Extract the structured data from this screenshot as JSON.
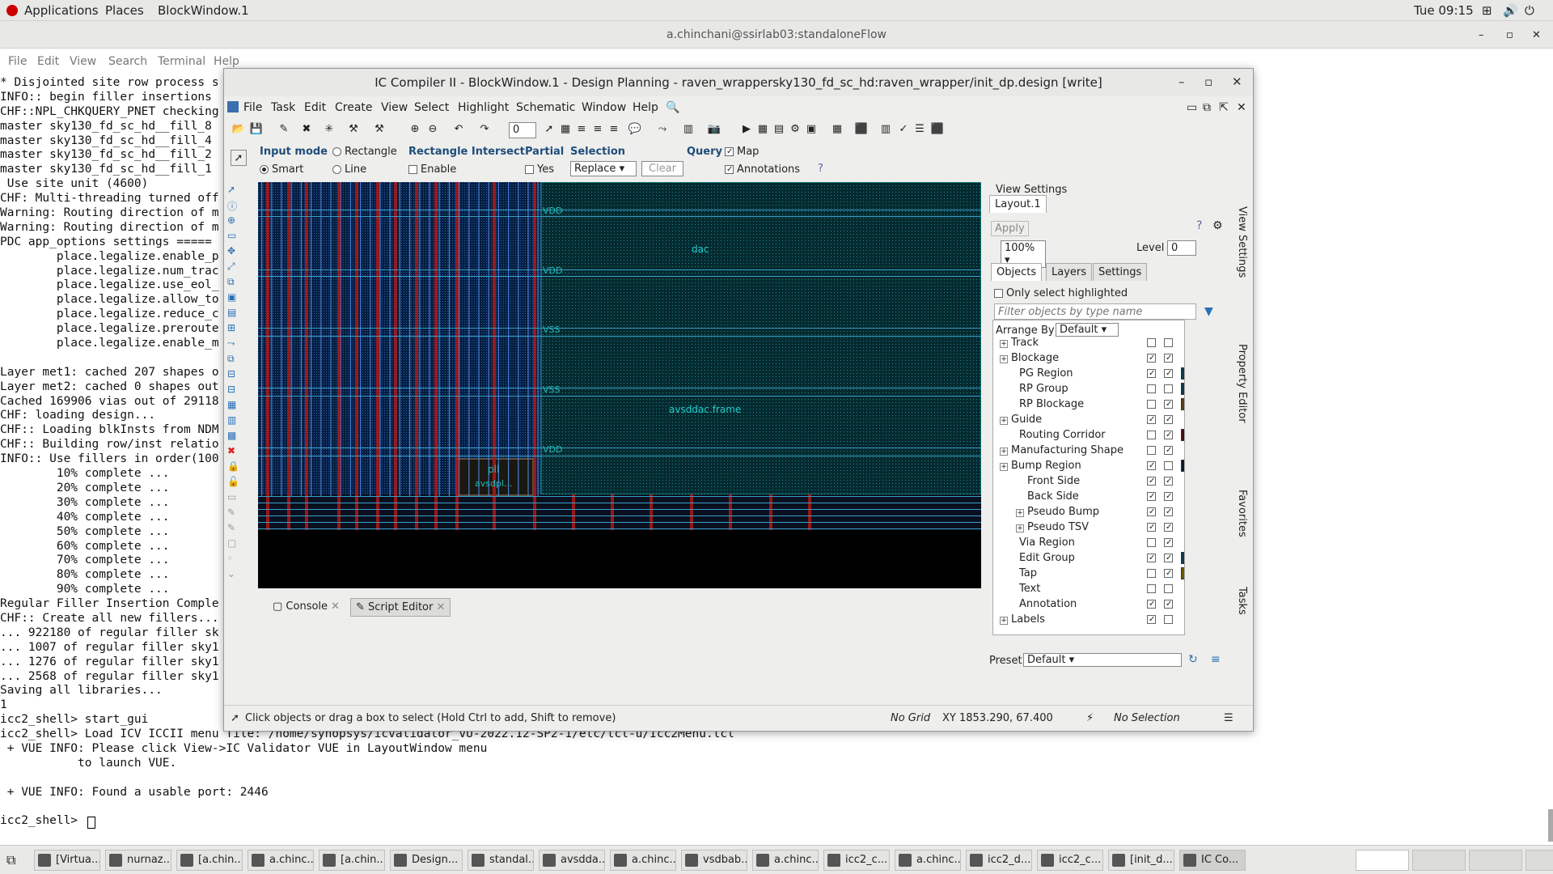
{
  "topbar": {
    "applications": "Applications",
    "places": "Places",
    "window": "BlockWindow.1",
    "clock": "Tue 09:15"
  },
  "terminal": {
    "title": "a.chinchani@ssirlab03:standaloneFlow",
    "menu": [
      "File",
      "Edit",
      "View",
      "Search",
      "Terminal",
      "Help"
    ],
    "lines": [
      "* Disjointed site row process s",
      "INFO:: begin filler insertions",
      "CHF::NPL_CHKQUERY_PNET checking",
      "master sky130_fd_sc_hd__fill_8",
      "master sky130_fd_sc_hd__fill_4",
      "master sky130_fd_sc_hd__fill_2",
      "master sky130_fd_sc_hd__fill_1",
      " Use site unit (4600)",
      "CHF: Multi-threading turned off",
      "Warning: Routing direction of m",
      "Warning: Routing direction of m",
      "PDC app_options settings =====",
      "        place.legalize.enable_p",
      "        place.legalize.num_trac",
      "        place.legalize.use_eol_",
      "        place.legalize.allow_to",
      "        place.legalize.reduce_c",
      "        place.legalize.preroute",
      "        place.legalize.enable_m",
      "",
      "Layer met1: cached 207 shapes o",
      "Layer met2: cached 0 shapes out",
      "Cached 169906 vias out of 29118",
      "CHF: loading design...",
      "CHF:: Loading blkInsts from NDM",
      "CHF:: Building row/inst relatio",
      "INFO:: Use fillers in order(100",
      "        10% complete ...",
      "        20% complete ...",
      "        30% complete ...",
      "        40% complete ...",
      "        50% complete ...",
      "        60% complete ...",
      "        70% complete ...",
      "        80% complete ...",
      "        90% complete ...",
      "Regular Filler Insertion Comple",
      "CHF:: Create all new fillers...",
      "... 922180 of regular filler sk",
      "... 1007 of regular filler sky1",
      "... 1276 of regular filler sky1",
      "... 2568 of regular filler sky1",
      "Saving all libraries...",
      "1",
      "icc2_shell> start_gui",
      "icc2_shell> Load ICV ICCII menu file: /home/synopsys/icvalidator_vU-2022.12-SP2-1/etc/tcl-u/Icc2Menu.tcl",
      " + VUE INFO: Please click View->IC Validator VUE in LayoutWindow menu",
      "           to launch VUE.",
      "",
      " + VUE INFO: Found a usable port: 2446",
      "",
      "icc2_shell> "
    ]
  },
  "window": {
    "title": "IC Compiler II - BlockWindow.1 - Design Planning - raven_wrappersky130_fd_sc_hd:raven_wrapper/init_dp.design [write]",
    "menu": [
      "File",
      "Task",
      "Edit",
      "Create",
      "View",
      "Select",
      "Highlight",
      "Schematic",
      "Window",
      "Help"
    ],
    "toolbar_value": "0",
    "options": {
      "input_mode": "Input mode",
      "rectangle": "Rectangle",
      "smart": "Smart",
      "line": "Line",
      "rect_intersect": "Rectangle Intersect",
      "enable": "Enable",
      "partial": "Partial",
      "yes": "Yes",
      "selection": "Selection",
      "replace": "Replace",
      "clear": "Clear",
      "query": "Query",
      "map": "Map",
      "annotations": "Annotations"
    },
    "canvas_labels": {
      "vdd1": "VDD",
      "vdd2": "VDD",
      "vss1": "VSS",
      "vss2": "VSS",
      "vdd3": "VDD",
      "dac": "dac",
      "frame": "avsddac.frame",
      "pll": "pll",
      "avsdpll": "avsdpl..."
    },
    "bottom_tabs": [
      "Console",
      "Script Editor"
    ],
    "status": {
      "hint": "Click objects or drag a box to select (Hold Ctrl to add, Shift to remove)",
      "grid": "No Grid",
      "xy": "XY 1853.290, 67.400",
      "selection": "No Selection"
    }
  },
  "panel": {
    "title": "View Settings",
    "layout_tab": "Layout.1",
    "apply": "Apply",
    "zoom": "100%",
    "level_label": "Level",
    "level": "0",
    "tabs": [
      "Objects",
      "Layers",
      "Settings"
    ],
    "only_highlighted": "Only select highlighted",
    "filter_placeholder": "Filter objects by type name",
    "arrange_label": "Arrange By",
    "arrange_value": "Default",
    "preset_label": "Preset",
    "preset_value": "Default",
    "vtabs": [
      "View Settings",
      "Property Editor",
      "Favorites",
      "Tasks"
    ],
    "tree": [
      {
        "label": "Track",
        "indent": 0,
        "exp": true,
        "c1": false,
        "c2": false,
        "sw": ""
      },
      {
        "label": "Blockage",
        "indent": 0,
        "exp": true,
        "c1": true,
        "c2": true,
        "sw": ""
      },
      {
        "label": "PG Region",
        "indent": 1,
        "exp": false,
        "c1": true,
        "c2": true,
        "sw": "#0d3b4a"
      },
      {
        "label": "RP Group",
        "indent": 1,
        "exp": false,
        "c1": false,
        "c2": false,
        "sw": "#0d3b4a"
      },
      {
        "label": "RP Blockage",
        "indent": 1,
        "exp": false,
        "c1": false,
        "c2": true,
        "sw": "#5a4010"
      },
      {
        "label": "Guide",
        "indent": 0,
        "exp": true,
        "c1": true,
        "c2": true,
        "sw": ""
      },
      {
        "label": "Routing Corridor",
        "indent": 1,
        "exp": false,
        "c1": false,
        "c2": true,
        "sw": "#4a0d0d"
      },
      {
        "label": "Manufacturing Shape",
        "indent": 0,
        "exp": true,
        "c1": false,
        "c2": true,
        "sw": ""
      },
      {
        "label": "Bump Region",
        "indent": 0,
        "exp": true,
        "c1": true,
        "c2": false,
        "sw": "#0d1a2e"
      },
      {
        "label": "Front Side",
        "indent": 2,
        "exp": false,
        "c1": true,
        "c2": true,
        "sw": ""
      },
      {
        "label": "Back Side",
        "indent": 2,
        "exp": false,
        "c1": true,
        "c2": true,
        "sw": ""
      },
      {
        "label": "Pseudo Bump",
        "indent": 2,
        "exp": true,
        "c1": true,
        "c2": true,
        "sw": ""
      },
      {
        "label": "Pseudo TSV",
        "indent": 2,
        "exp": true,
        "c1": true,
        "c2": true,
        "sw": ""
      },
      {
        "label": "Via Region",
        "indent": 1,
        "exp": false,
        "c1": false,
        "c2": true,
        "sw": ""
      },
      {
        "label": "Edit Group",
        "indent": 1,
        "exp": false,
        "c1": true,
        "c2": true,
        "sw": "#0d3b4a"
      },
      {
        "label": "Tap",
        "indent": 1,
        "exp": false,
        "c1": false,
        "c2": true,
        "sw": "#6a5a00"
      },
      {
        "label": "Text",
        "indent": 1,
        "exp": false,
        "c1": false,
        "c2": false,
        "sw": ""
      },
      {
        "label": "Annotation",
        "indent": 1,
        "exp": false,
        "c1": true,
        "c2": true,
        "sw": ""
      },
      {
        "label": "Labels",
        "indent": 0,
        "exp": true,
        "c1": true,
        "c2": false,
        "sw": ""
      }
    ]
  },
  "taskbar": [
    "[Virtua...",
    "nurnaz...",
    "[a.chin...",
    "a.chinc...",
    "[a.chin...",
    "Design...",
    "standal...",
    "avsdda...",
    "a.chinc...",
    "vsdbab...",
    "a.chinc...",
    "icc2_c...",
    "a.chinc...",
    "icc2_d...",
    "icc2_c...",
    "[init_d...",
    "IC Co..."
  ]
}
